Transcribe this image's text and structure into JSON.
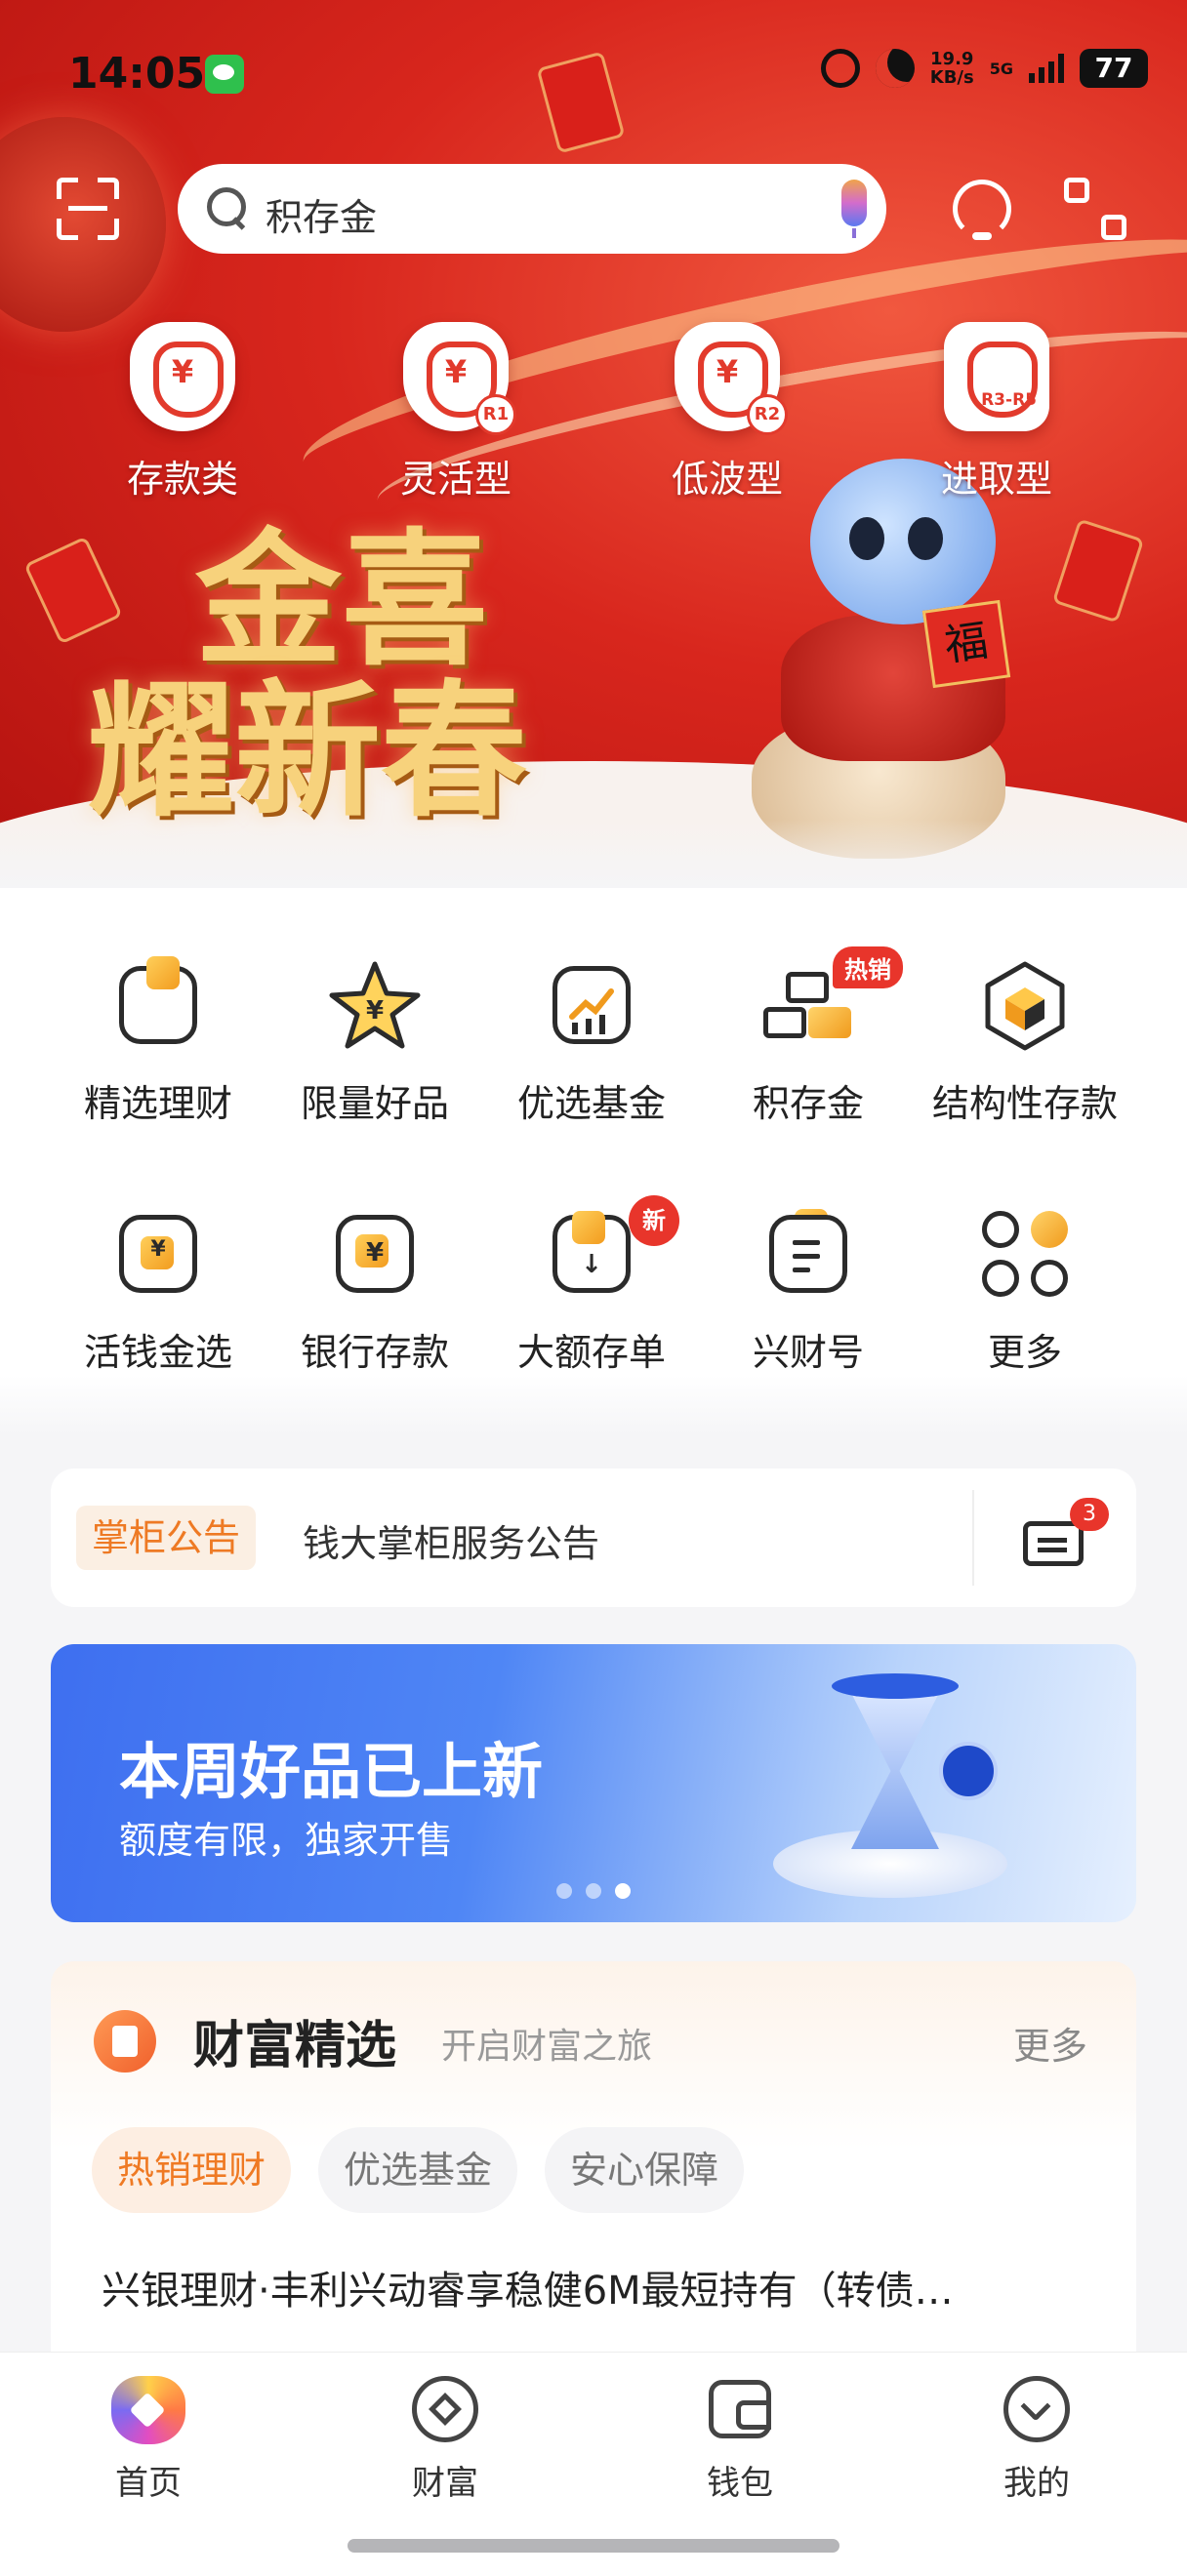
{
  "status_bar": {
    "time": "14:05",
    "speed_top": "19.9",
    "speed_bottom": "KB/s",
    "network": "5G",
    "battery": "77"
  },
  "search": {
    "placeholder": "积存金"
  },
  "hero": {
    "categories": [
      {
        "label": "存款类",
        "tag": ""
      },
      {
        "label": "灵活型",
        "tag": "R1"
      },
      {
        "label": "低波型",
        "tag": "R2"
      },
      {
        "label": "进取型",
        "tag": "R3-R5"
      }
    ],
    "title_line1": "金喜",
    "title_line2": "耀新春",
    "mascot_tag": "福"
  },
  "quick_menu": {
    "items": [
      {
        "label": "精选理财",
        "badge": ""
      },
      {
        "label": "限量好品",
        "badge": ""
      },
      {
        "label": "优选基金",
        "badge": ""
      },
      {
        "label": "积存金",
        "badge": "热销"
      },
      {
        "label": "结构性存款",
        "badge": ""
      },
      {
        "label": "活钱金选",
        "badge": ""
      },
      {
        "label": "银行存款",
        "badge": ""
      },
      {
        "label": "大额存单",
        "badge": "新"
      },
      {
        "label": "兴财号",
        "badge": ""
      },
      {
        "label": "更多",
        "badge": ""
      }
    ]
  },
  "notice": {
    "tag": "掌柜公告",
    "text": "钱大掌柜服务公告",
    "message_count": "3"
  },
  "promo": {
    "title": "本周好品已上新",
    "subtitle": "额度有限，独家开售",
    "active_dot": 3,
    "dot_count": 3
  },
  "wealth": {
    "title": "财富精选",
    "subtitle": "开启财富之旅",
    "more": "更多",
    "tabs": [
      {
        "label": "热销理财",
        "active": true
      },
      {
        "label": "优选基金",
        "active": false
      },
      {
        "label": "安心保障",
        "active": false
      }
    ],
    "product_title": "兴银理财·丰利兴动睿享稳健6M最短持有（转债…"
  },
  "bottom_nav": {
    "items": [
      {
        "label": "首页",
        "icon": "home-icon",
        "active": true
      },
      {
        "label": "财富",
        "icon": "wealth-icon",
        "active": false
      },
      {
        "label": "钱包",
        "icon": "wallet-icon",
        "active": false
      },
      {
        "label": "我的",
        "icon": "profile-icon",
        "active": false
      }
    ]
  },
  "colors": {
    "accent_orange": "#ef7a24",
    "badge_red": "#e8352b",
    "hero_red": "#d8261d"
  }
}
